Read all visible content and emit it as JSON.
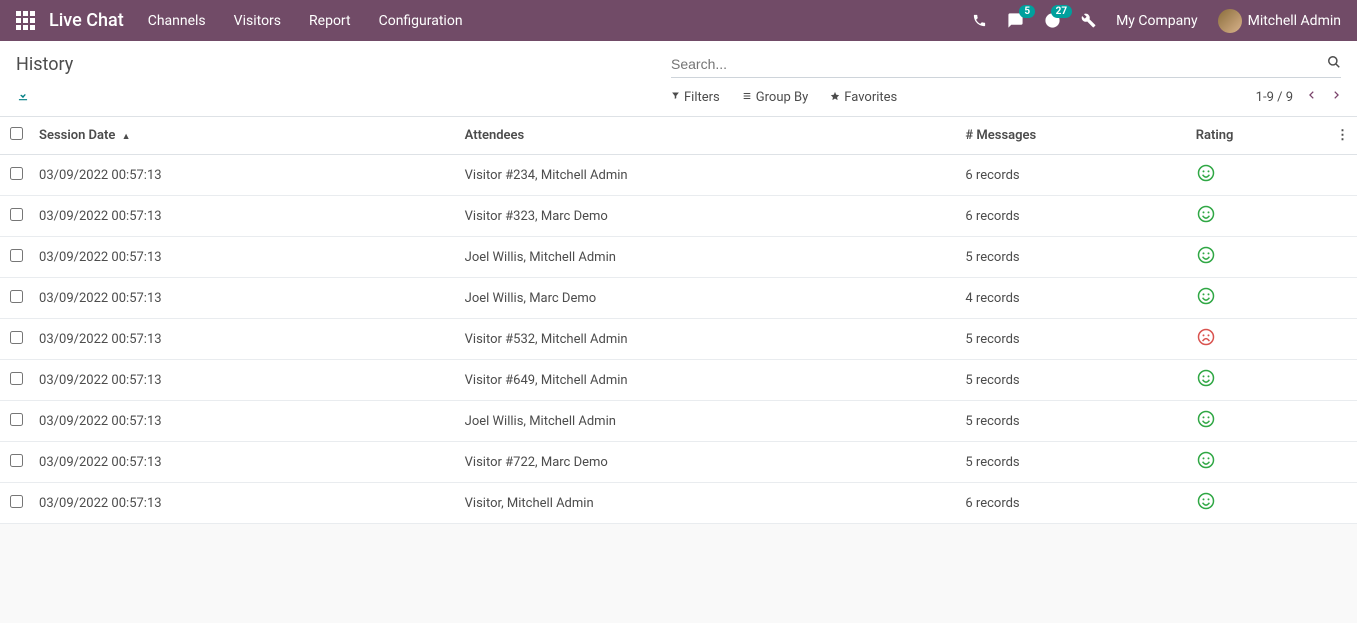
{
  "topbar": {
    "brand": "Live Chat",
    "menu": [
      "Channels",
      "Visitors",
      "Report",
      "Configuration"
    ],
    "chat_badge": "5",
    "clock_badge": "27",
    "company": "My Company",
    "user": "Mitchell Admin"
  },
  "control": {
    "title": "History",
    "search_placeholder": "Search...",
    "filters": "Filters",
    "groupby": "Group By",
    "favorites": "Favorites",
    "pager": "1-9 / 9"
  },
  "table": {
    "headers": {
      "date": "Session Date",
      "attendees": "Attendees",
      "messages": "# Messages",
      "rating": "Rating"
    },
    "rows": [
      {
        "date": "03/09/2022 00:57:13",
        "attendees": "Visitor #234, Mitchell Admin",
        "messages": "6 records",
        "rating": "happy"
      },
      {
        "date": "03/09/2022 00:57:13",
        "attendees": "Visitor #323, Marc Demo",
        "messages": "6 records",
        "rating": "happy"
      },
      {
        "date": "03/09/2022 00:57:13",
        "attendees": "Joel Willis, Mitchell Admin",
        "messages": "5 records",
        "rating": "happy"
      },
      {
        "date": "03/09/2022 00:57:13",
        "attendees": "Joel Willis, Marc Demo",
        "messages": "4 records",
        "rating": "happy"
      },
      {
        "date": "03/09/2022 00:57:13",
        "attendees": "Visitor #532, Mitchell Admin",
        "messages": "5 records",
        "rating": "sad"
      },
      {
        "date": "03/09/2022 00:57:13",
        "attendees": "Visitor #649, Mitchell Admin",
        "messages": "5 records",
        "rating": "happy"
      },
      {
        "date": "03/09/2022 00:57:13",
        "attendees": "Joel Willis, Mitchell Admin",
        "messages": "5 records",
        "rating": "happy"
      },
      {
        "date": "03/09/2022 00:57:13",
        "attendees": "Visitor #722, Marc Demo",
        "messages": "5 records",
        "rating": "happy"
      },
      {
        "date": "03/09/2022 00:57:13",
        "attendees": "Visitor, Mitchell Admin",
        "messages": "6 records",
        "rating": "happy"
      }
    ]
  }
}
